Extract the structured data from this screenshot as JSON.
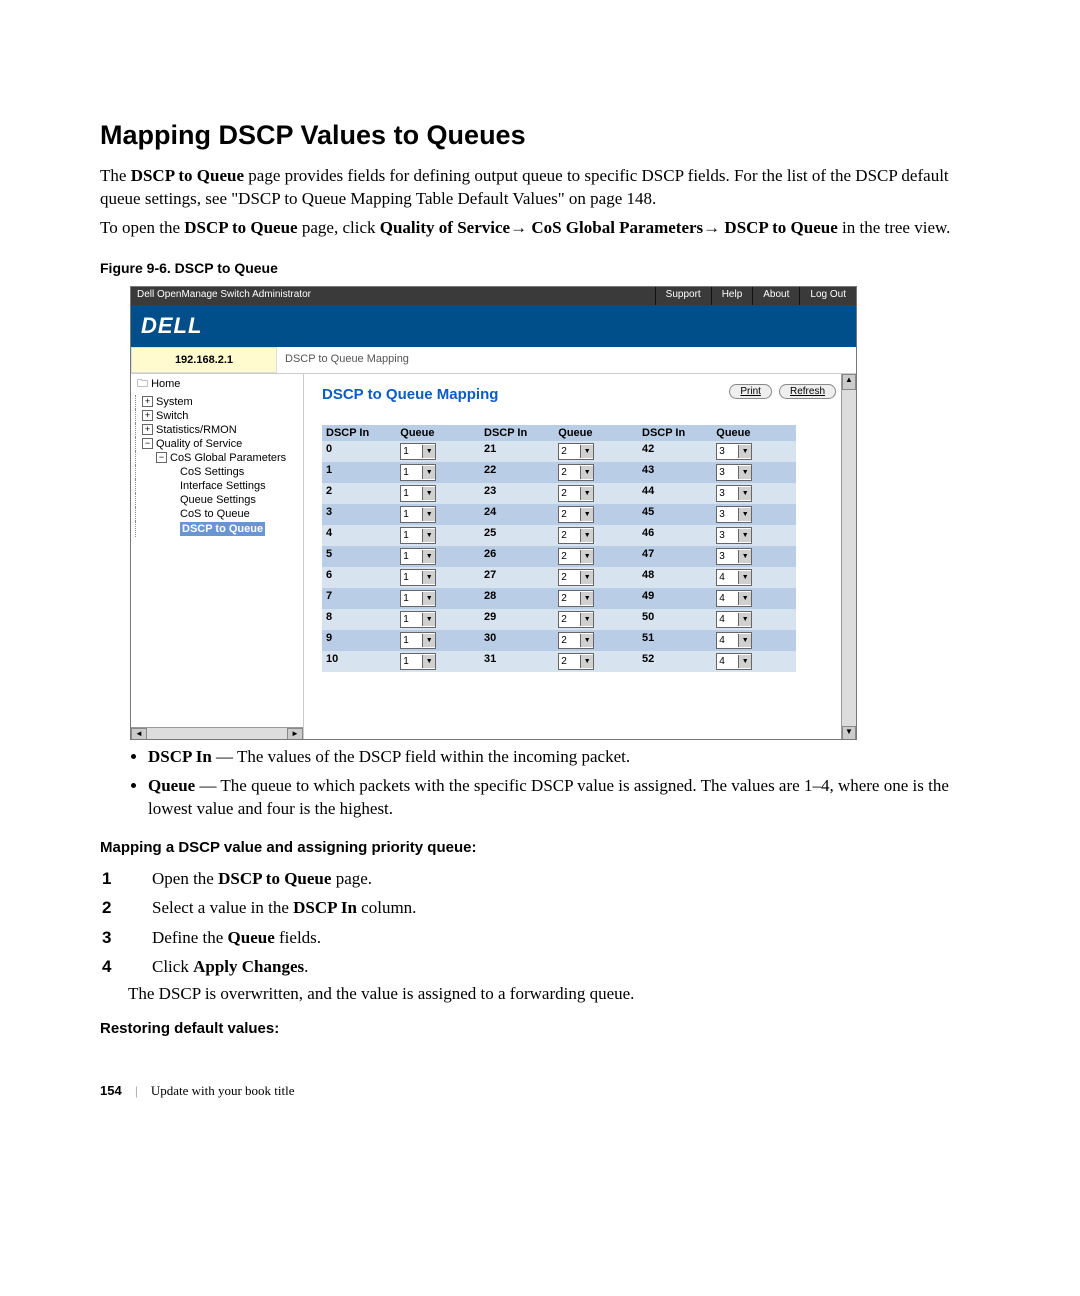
{
  "title": "Mapping DSCP Values to Queues",
  "intro": {
    "p1a": "The ",
    "p1b": "DSCP to Queue",
    "p1c": " page provides fields for defining output queue to specific DSCP fields. For the list of the DSCP default queue settings, see \"DSCP to Queue Mapping Table Default Values\" on page 148.",
    "p2a": "To open the ",
    "p2b": "DSCP to Queue",
    "p2c": " page, click ",
    "p2d": "Quality of Service",
    "p2e": "→ ",
    "p2f": "CoS Global Parameters",
    "p2g": "→ ",
    "p2h": "DSCP to Queue",
    "p2i": " in the tree view."
  },
  "figcap": "Figure 9-6.    DSCP to Queue",
  "app": {
    "wintitle": "Dell OpenManage Switch Administrator",
    "menu": {
      "support": "Support",
      "help": "Help",
      "about": "About",
      "logout": "Log Out"
    },
    "brand": "DELL",
    "ip": "192.168.2.1",
    "breadcrumb": "DSCP to Queue Mapping",
    "nav": {
      "home": "Home",
      "system": "System",
      "switch": "Switch",
      "stats": "Statistics/RMON",
      "qos": "Quality of Service",
      "cosglobal": "CoS Global Parameters",
      "cossettings": "CoS Settings",
      "ifsettings": "Interface Settings",
      "qsettings": "Queue Settings",
      "ctq": "CoS to Queue",
      "dtq": "DSCP to Queue"
    },
    "content": {
      "heading": "DSCP to Queue Mapping",
      "print": "Print",
      "refresh": "Refresh",
      "hdr_dscp": "DSCP In",
      "hdr_queue": "Queue",
      "col1": [
        {
          "d": "0",
          "q": "1"
        },
        {
          "d": "1",
          "q": "1"
        },
        {
          "d": "2",
          "q": "1"
        },
        {
          "d": "3",
          "q": "1"
        },
        {
          "d": "4",
          "q": "1"
        },
        {
          "d": "5",
          "q": "1"
        },
        {
          "d": "6",
          "q": "1"
        },
        {
          "d": "7",
          "q": "1"
        },
        {
          "d": "8",
          "q": "1"
        },
        {
          "d": "9",
          "q": "1"
        },
        {
          "d": "10",
          "q": "1"
        }
      ],
      "col2": [
        {
          "d": "21",
          "q": "2"
        },
        {
          "d": "22",
          "q": "2"
        },
        {
          "d": "23",
          "q": "2"
        },
        {
          "d": "24",
          "q": "2"
        },
        {
          "d": "25",
          "q": "2"
        },
        {
          "d": "26",
          "q": "2"
        },
        {
          "d": "27",
          "q": "2"
        },
        {
          "d": "28",
          "q": "2"
        },
        {
          "d": "29",
          "q": "2"
        },
        {
          "d": "30",
          "q": "2"
        },
        {
          "d": "31",
          "q": "2"
        }
      ],
      "col3": [
        {
          "d": "42",
          "q": "3"
        },
        {
          "d": "43",
          "q": "3"
        },
        {
          "d": "44",
          "q": "3"
        },
        {
          "d": "45",
          "q": "3"
        },
        {
          "d": "46",
          "q": "3"
        },
        {
          "d": "47",
          "q": "3"
        },
        {
          "d": "48",
          "q": "4"
        },
        {
          "d": "49",
          "q": "4"
        },
        {
          "d": "50",
          "q": "4"
        },
        {
          "d": "51",
          "q": "4"
        },
        {
          "d": "52",
          "q": "4"
        }
      ]
    }
  },
  "bullets": {
    "b1a": "DSCP In",
    "b1b": " — The values of the DSCP field within the incoming packet.",
    "b2a": "Queue",
    "b2b": " — The queue to which packets with the specific DSCP value is assigned. The values are 1–4, where one is the lowest value and four is the highest."
  },
  "sub1": "Mapping a DSCP value and assigning priority queue:",
  "steps": {
    "s1a": "Open the ",
    "s1b": "DSCP to Queue",
    "s1c": " page.",
    "s2a": "Select a value in the ",
    "s2b": "DSCP In",
    "s2c": " column.",
    "s3a": "Define the ",
    "s3b": "Queue",
    "s3c": " fields.",
    "s4a": "Click ",
    "s4b": "Apply Changes",
    "s4c": ".",
    "note": "The DSCP is overwritten, and the value is assigned to a forwarding queue."
  },
  "sub2": "Restoring default values:",
  "footer": {
    "page": "154",
    "book": "Update with your book title"
  }
}
